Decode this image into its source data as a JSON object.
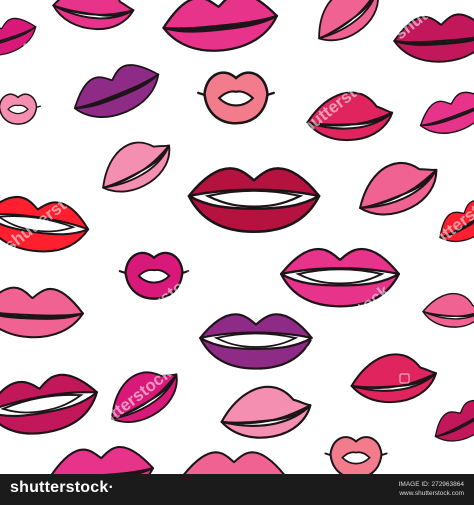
{
  "image": {
    "subject": "lips-pattern",
    "background": "#ffffff",
    "outline_color": "#1d1418",
    "palette": [
      "#e8338a",
      "#d9197a",
      "#c2185b",
      "#8e2b86",
      "#e0245e",
      "#f06292",
      "#f48fb1",
      "#ff1f2f",
      "#b5123f",
      "#f27b8c"
    ]
  },
  "watermark": {
    "text": "shutterstock",
    "icon": "shutterstock-camera-icon"
  },
  "footer": {
    "logo": "shutterstock",
    "logo_suffix": "·",
    "image_id_label": "IMAGE ID: 272963864",
    "site": "www.shutterstock.com"
  }
}
